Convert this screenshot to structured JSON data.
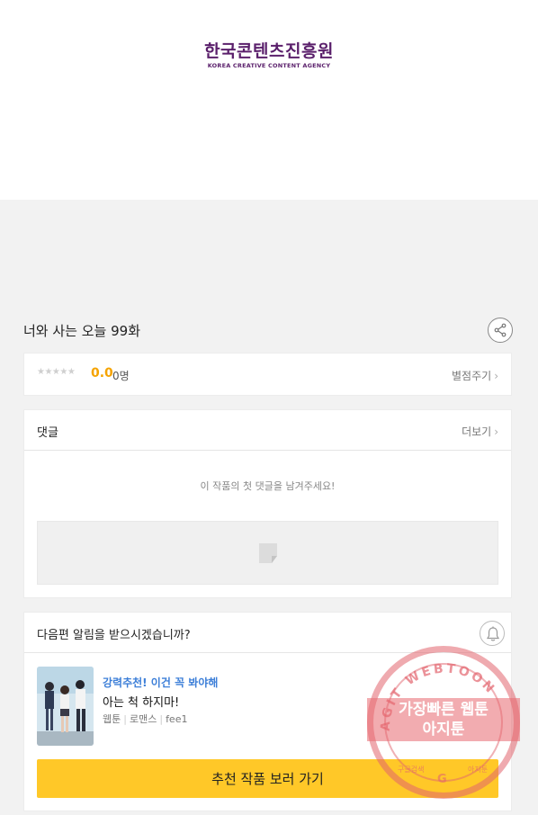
{
  "banner": {
    "logo_ko": "한국콘텐츠진흥원",
    "logo_en": "KOREA CREATIVE CONTENT AGENCY"
  },
  "episode": {
    "title": "너와 사는 오늘 99화"
  },
  "rating": {
    "stars": "★★★★★",
    "score": "0.0",
    "count": "0명",
    "rate_link": "별점주기"
  },
  "comments": {
    "title": "댓글",
    "more": "더보기",
    "empty_message": "이 작품의 첫 댓글을 남겨주세요!"
  },
  "notify": {
    "title": "다음편 알림을 받으시겠습니까?"
  },
  "recommendation": {
    "tag": "강력추천! 이건 꼭 봐야해",
    "title": "아는 척 하지마!",
    "genre1": "웹툰",
    "genre2": "로맨스",
    "genre3": "fee1",
    "button": "추천 작품 보러 가기"
  },
  "watermark": {
    "arc_text": "AGIT WEBTOON",
    "line1": "가장빠른 웹툰",
    "line2": "아지툰",
    "bottom_left": "구글검색",
    "bottom_right": "아지툰"
  },
  "colors": {
    "accent_yellow": "#ffc828",
    "score_orange": "#f5a300",
    "tag_blue": "#3d7fd8",
    "logo_purple": "#5a1f6b"
  },
  "icons": [
    "share-icon",
    "chevron-right-icon",
    "document-icon",
    "bell-icon"
  ]
}
